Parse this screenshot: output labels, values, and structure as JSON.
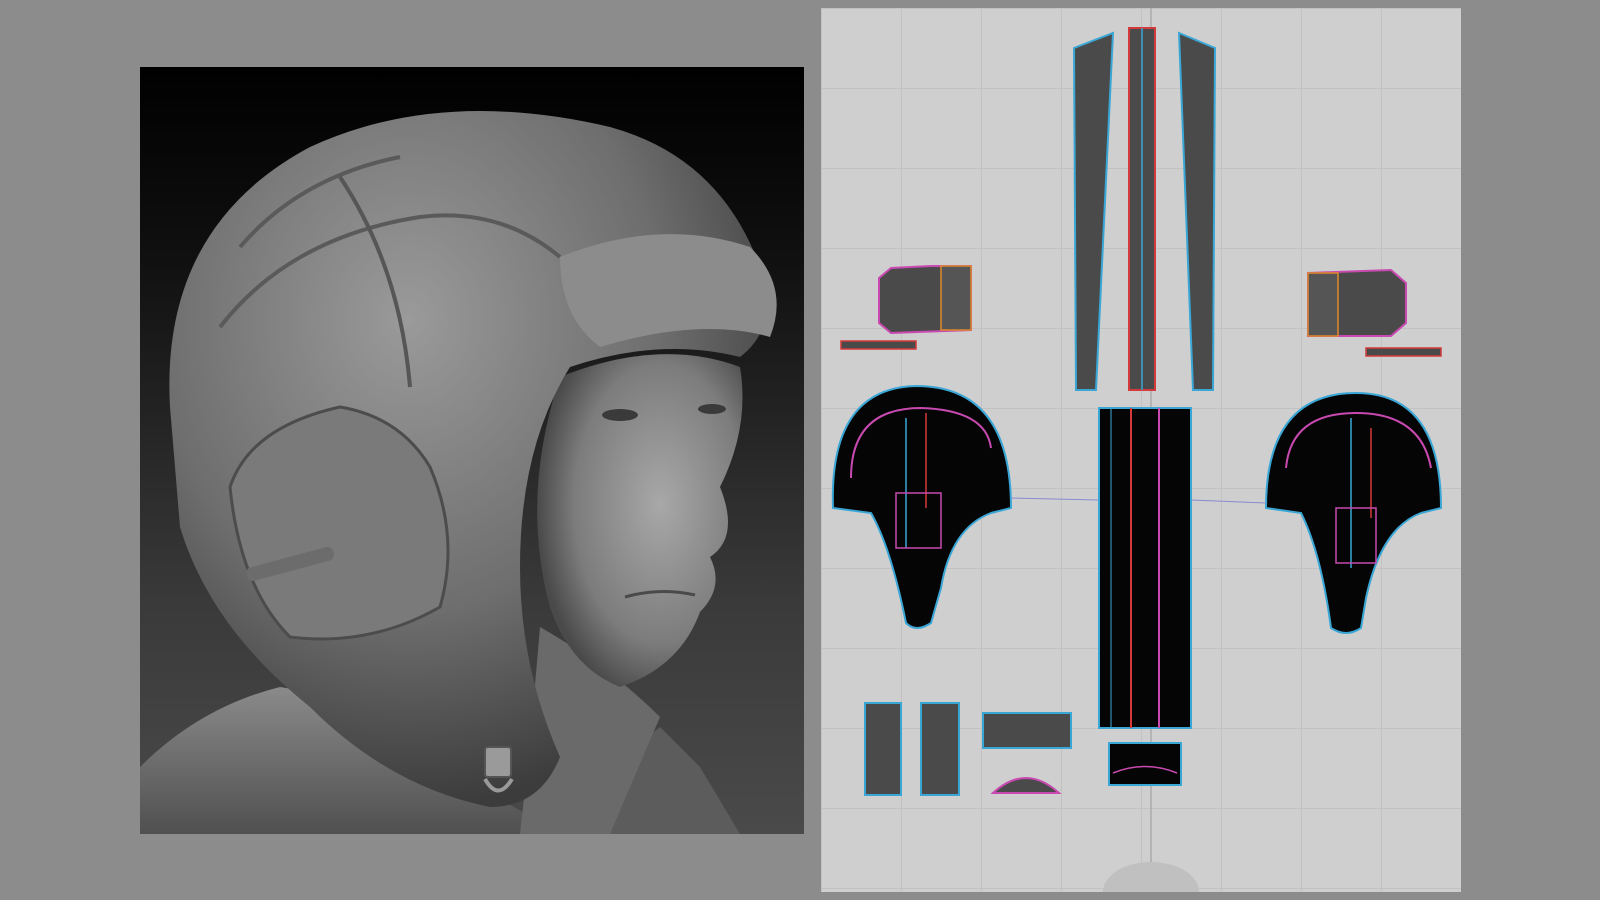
{
  "scene": {
    "left_panel": "3d-sculpt-render",
    "right_panel": "sewing-pattern-layout"
  },
  "colors": {
    "background": "#8c8c8c",
    "pattern_background": "#cfcfcf",
    "piece_fill": "#4a4a4a",
    "piece_dark": "#050505",
    "seam_blue": "#3aa6d6",
    "seam_red": "#d43a3a",
    "seam_pink": "#c84ab0",
    "seam_orange": "#e08a2a"
  }
}
